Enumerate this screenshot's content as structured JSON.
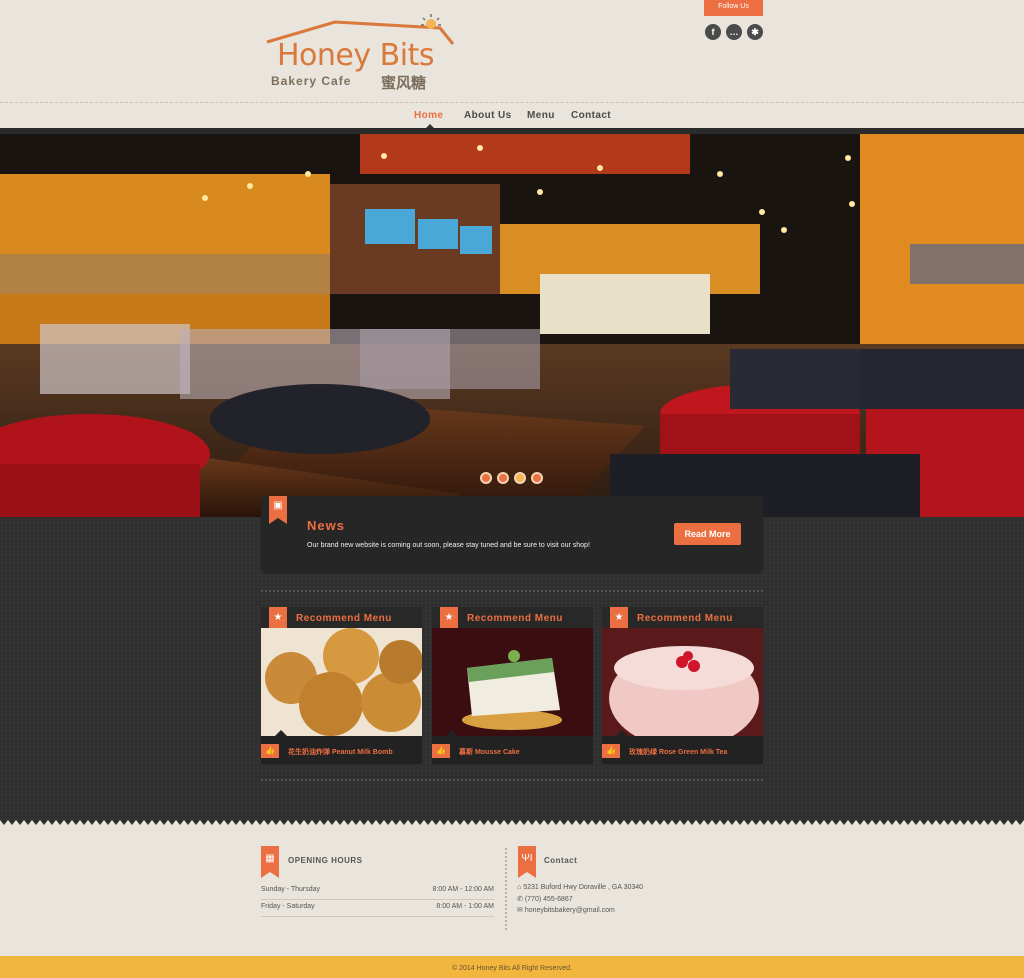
{
  "brand": {
    "name": "Honey Bits",
    "subtitle": "Bakery Cafe",
    "chinese": "蜜风糖"
  },
  "header": {
    "follow_label": "Follow Us",
    "social": [
      {
        "icon": "facebook-icon",
        "glyph": "f"
      },
      {
        "icon": "chat-icon",
        "glyph": "…"
      },
      {
        "icon": "yelp-icon",
        "glyph": "✱"
      }
    ]
  },
  "nav": {
    "items": [
      "Home",
      "About Us",
      "Menu",
      "Contact"
    ],
    "active": "Home"
  },
  "slider": {
    "dots": 4,
    "active_index": 2
  },
  "news": {
    "title": "News",
    "text": "Our brand new website is coming out soon, please stay tuned and be sure to visit our shop!",
    "button": "Read More"
  },
  "recommend": [
    {
      "title": "Recommend Menu",
      "caption": "花生奶油炸弹 Peanut Milk Bomb"
    },
    {
      "title": "Recommend Menu",
      "caption": "慕斯 Mousse Cake"
    },
    {
      "title": "Recommend Menu",
      "caption": "玫瑰奶绿 Rose Green Milk Tea"
    }
  ],
  "hours": {
    "title": "OPENING HOURS",
    "rows": [
      {
        "days": "Sunday - Thursday",
        "time": "8:00 AM - 12:00 AM"
      },
      {
        "days": "Friday - Saturday",
        "time": "8:00 AM - 1:00 AM"
      }
    ]
  },
  "contact": {
    "title": "Contact",
    "address": "5231 Buford Hwy Doraville , GA 30340",
    "phone": "(770) 455-6867",
    "email": "honeybitsbakery@gmail.com"
  },
  "copyright": "© 2014 Honey Bits All Right Reserved.",
  "colors": {
    "accent": "#ec6f42",
    "dark_bg": "#2f2f2f",
    "light_bg": "#e9e5dc",
    "footer_bar": "#f2b63f"
  }
}
